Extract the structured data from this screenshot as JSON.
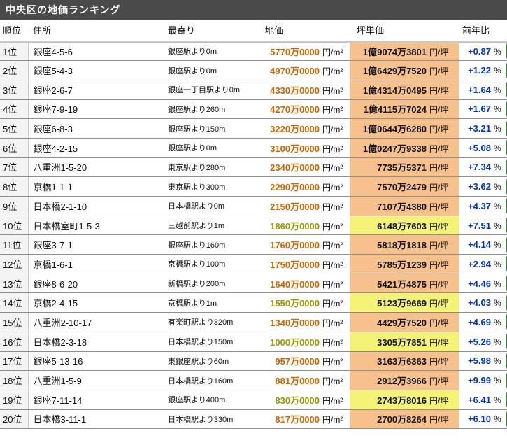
{
  "title": "中央区の地価ランキング",
  "columns": {
    "rank": "順位",
    "address": "住所",
    "station": "最寄り",
    "price": "地価",
    "tsubo": "坪単価",
    "yoy": "前年比"
  },
  "units": {
    "price": "円/m²",
    "tsubo": "円/坪",
    "yoy": "%"
  },
  "colors": {
    "title_bar_bg": "#4a4a4a",
    "price_text": "#cc6600",
    "price_text_highlight": "#999900",
    "tsubo_bg": "#f7c18e",
    "tsubo_bg_highlight": "#f4f378",
    "yoy_text": "#0033cc",
    "action_green": "#33cc33",
    "rank_cell_bg": "#f4f4f4"
  },
  "rows": [
    {
      "rank": "1位",
      "address": "銀座4-5-6",
      "station": "銀座駅より0m",
      "price": "5770万0000",
      "tsubo": "1億9074万3801",
      "yoy": "+0.87",
      "highlight": false
    },
    {
      "rank": "2位",
      "address": "銀座5-4-3",
      "station": "銀座駅より0m",
      "price": "4970万0000",
      "tsubo": "1億6429万7520",
      "yoy": "+1.22",
      "highlight": false
    },
    {
      "rank": "3位",
      "address": "銀座2-6-7",
      "station": "銀座一丁目駅より0m",
      "price": "4330万0000",
      "tsubo": "1億4314万0495",
      "yoy": "+1.64",
      "highlight": false
    },
    {
      "rank": "4位",
      "address": "銀座7-9-19",
      "station": "銀座駅より260m",
      "price": "4270万0000",
      "tsubo": "1億4115万7024",
      "yoy": "+1.67",
      "highlight": false
    },
    {
      "rank": "5位",
      "address": "銀座6-8-3",
      "station": "銀座駅より150m",
      "price": "3220万0000",
      "tsubo": "1億0644万6280",
      "yoy": "+3.21",
      "highlight": false
    },
    {
      "rank": "6位",
      "address": "銀座4-2-15",
      "station": "銀座駅より0m",
      "price": "3100万0000",
      "tsubo": "1億0247万9338",
      "yoy": "+5.08",
      "highlight": false
    },
    {
      "rank": "7位",
      "address": "八重洲1-5-20",
      "station": "東京駅より280m",
      "price": "2340万0000",
      "tsubo": "7735万5371",
      "yoy": "+7.34",
      "highlight": false
    },
    {
      "rank": "8位",
      "address": "京橋1-1-1",
      "station": "東京駅より300m",
      "price": "2290万0000",
      "tsubo": "7570万2479",
      "yoy": "+3.62",
      "highlight": false
    },
    {
      "rank": "9位",
      "address": "日本橋2-1-10",
      "station": "日本橋駅より0m",
      "price": "2150万0000",
      "tsubo": "7107万4380",
      "yoy": "+4.37",
      "highlight": false
    },
    {
      "rank": "10位",
      "address": "日本橋室町1-5-3",
      "station": "三越前駅より1m",
      "price": "1860万0000",
      "tsubo": "6148万7603",
      "yoy": "+7.51",
      "highlight": true
    },
    {
      "rank": "11位",
      "address": "銀座3-7-1",
      "station": "銀座駅より160m",
      "price": "1760万0000",
      "tsubo": "5818万1818",
      "yoy": "+4.14",
      "highlight": false
    },
    {
      "rank": "12位",
      "address": "京橋1-6-1",
      "station": "京橋駅より100m",
      "price": "1750万0000",
      "tsubo": "5785万1239",
      "yoy": "+2.94",
      "highlight": false
    },
    {
      "rank": "13位",
      "address": "銀座8-6-20",
      "station": "新橋駅より200m",
      "price": "1640万0000",
      "tsubo": "5421万4875",
      "yoy": "+4.46",
      "highlight": false
    },
    {
      "rank": "14位",
      "address": "京橋2-4-15",
      "station": "京橋駅より1m",
      "price": "1550万0000",
      "tsubo": "5123万9669",
      "yoy": "+4.03",
      "highlight": true
    },
    {
      "rank": "15位",
      "address": "八重洲2-10-17",
      "station": "有楽町駅より320m",
      "price": "1340万0000",
      "tsubo": "4429万7520",
      "yoy": "+4.69",
      "highlight": false
    },
    {
      "rank": "16位",
      "address": "日本橋2-3-18",
      "station": "日本橋駅より150m",
      "price": "1000万0000",
      "tsubo": "3305万7851",
      "yoy": "+5.26",
      "highlight": true
    },
    {
      "rank": "17位",
      "address": "銀座5-13-16",
      "station": "東銀座駅より60m",
      "price": "957万0000",
      "tsubo": "3163万6363",
      "yoy": "+5.98",
      "highlight": false
    },
    {
      "rank": "18位",
      "address": "八重洲1-5-9",
      "station": "日本橋駅より160m",
      "price": "881万0000",
      "tsubo": "2912万3966",
      "yoy": "+9.99",
      "highlight": false
    },
    {
      "rank": "19位",
      "address": "銀座7-11-14",
      "station": "銀座駅より400m",
      "price": "830万0000",
      "tsubo": "2743万8016",
      "yoy": "+6.41",
      "highlight": true
    },
    {
      "rank": "20位",
      "address": "日本橋3-11-1",
      "station": "日本橋駅より330m",
      "price": "817万0000",
      "tsubo": "2700万8264",
      "yoy": "+6.10",
      "highlight": false
    }
  ]
}
